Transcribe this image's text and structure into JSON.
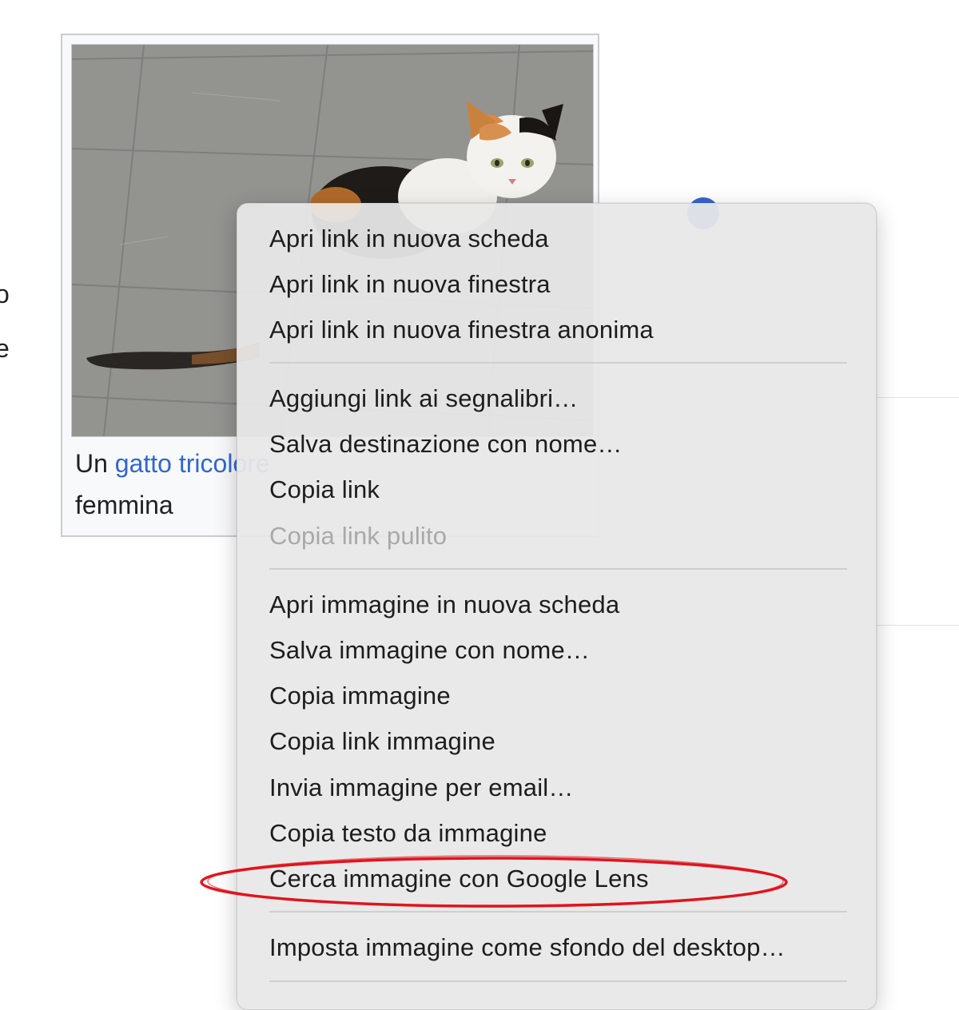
{
  "article": {
    "left_fragments": [
      "o",
      "e"
    ],
    "caption": {
      "prefix": "Un ",
      "link_text": "gatto tricolore",
      "second_line": "femmina"
    }
  },
  "context_menu": {
    "groups": [
      {
        "items": [
          {
            "label": "Apri link in nuova scheda",
            "enabled": true
          },
          {
            "label": "Apri link in nuova finestra",
            "enabled": true
          },
          {
            "label": "Apri link in nuova finestra anonima",
            "enabled": true
          }
        ]
      },
      {
        "items": [
          {
            "label": "Aggiungi link ai segnalibri…",
            "enabled": true
          },
          {
            "label": "Salva destinazione con nome…",
            "enabled": true
          },
          {
            "label": "Copia link",
            "enabled": true
          },
          {
            "label": "Copia link pulito",
            "enabled": false
          }
        ]
      },
      {
        "items": [
          {
            "label": "Apri immagine in nuova scheda",
            "enabled": true
          },
          {
            "label": "Salva immagine con nome…",
            "enabled": true
          },
          {
            "label": "Copia immagine",
            "enabled": true
          },
          {
            "label": "Copia link immagine",
            "enabled": true
          },
          {
            "label": "Invia immagine per email…",
            "enabled": true
          },
          {
            "label": "Copia testo da immagine",
            "enabled": true
          },
          {
            "label": "Cerca immagine con Google Lens",
            "enabled": true,
            "highlighted": true
          }
        ]
      },
      {
        "items": [
          {
            "label": "Imposta immagine come sfondo del desktop…",
            "enabled": true
          }
        ]
      }
    ]
  },
  "colors": {
    "link": "#3366cc",
    "highlight_ring": "#e0141e",
    "menu_background": "#e8e8e8",
    "disabled_text": "#a9a9a9"
  }
}
